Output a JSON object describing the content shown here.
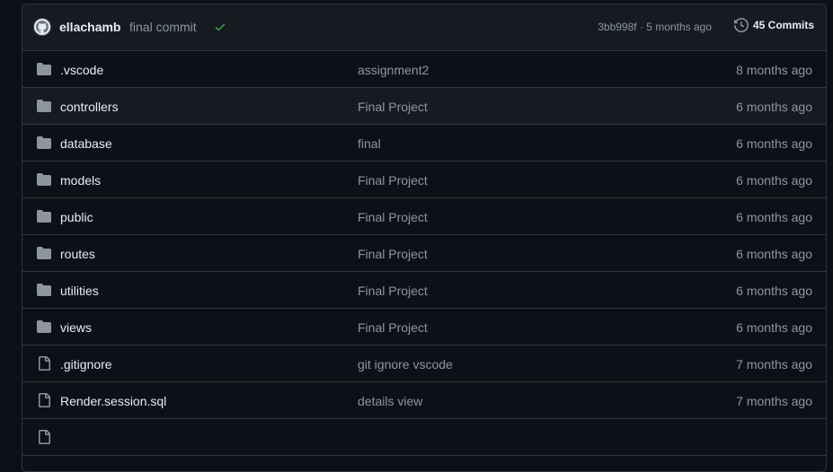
{
  "commit": {
    "author": "ellachamb",
    "message": "final commit",
    "hash_time": "3bb998f · 5 months ago",
    "commits_label": "45 Commits",
    "status_color": "#3fb950"
  },
  "files": [
    {
      "type": "folder",
      "name": ".vscode",
      "message": "assignment2",
      "age": "8 months ago"
    },
    {
      "type": "folder",
      "name": "controllers",
      "message": "Final Project",
      "age": "6 months ago"
    },
    {
      "type": "folder",
      "name": "database",
      "message": "final",
      "age": "6 months ago"
    },
    {
      "type": "folder",
      "name": "models",
      "message": "Final Project",
      "age": "6 months ago"
    },
    {
      "type": "folder",
      "name": "public",
      "message": "Final Project",
      "age": "6 months ago"
    },
    {
      "type": "folder",
      "name": "routes",
      "message": "Final Project",
      "age": "6 months ago"
    },
    {
      "type": "folder",
      "name": "utilities",
      "message": "Final Project",
      "age": "6 months ago"
    },
    {
      "type": "folder",
      "name": "views",
      "message": "Final Project",
      "age": "6 months ago"
    },
    {
      "type": "file",
      "name": ".gitignore",
      "message": "git ignore vscode",
      "age": "7 months ago"
    },
    {
      "type": "file",
      "name": "Render.session.sql",
      "message": "details view",
      "age": "7 months ago"
    },
    {
      "type": "file",
      "name": "",
      "message": "",
      "age": ""
    }
  ],
  "hover_row": 1
}
